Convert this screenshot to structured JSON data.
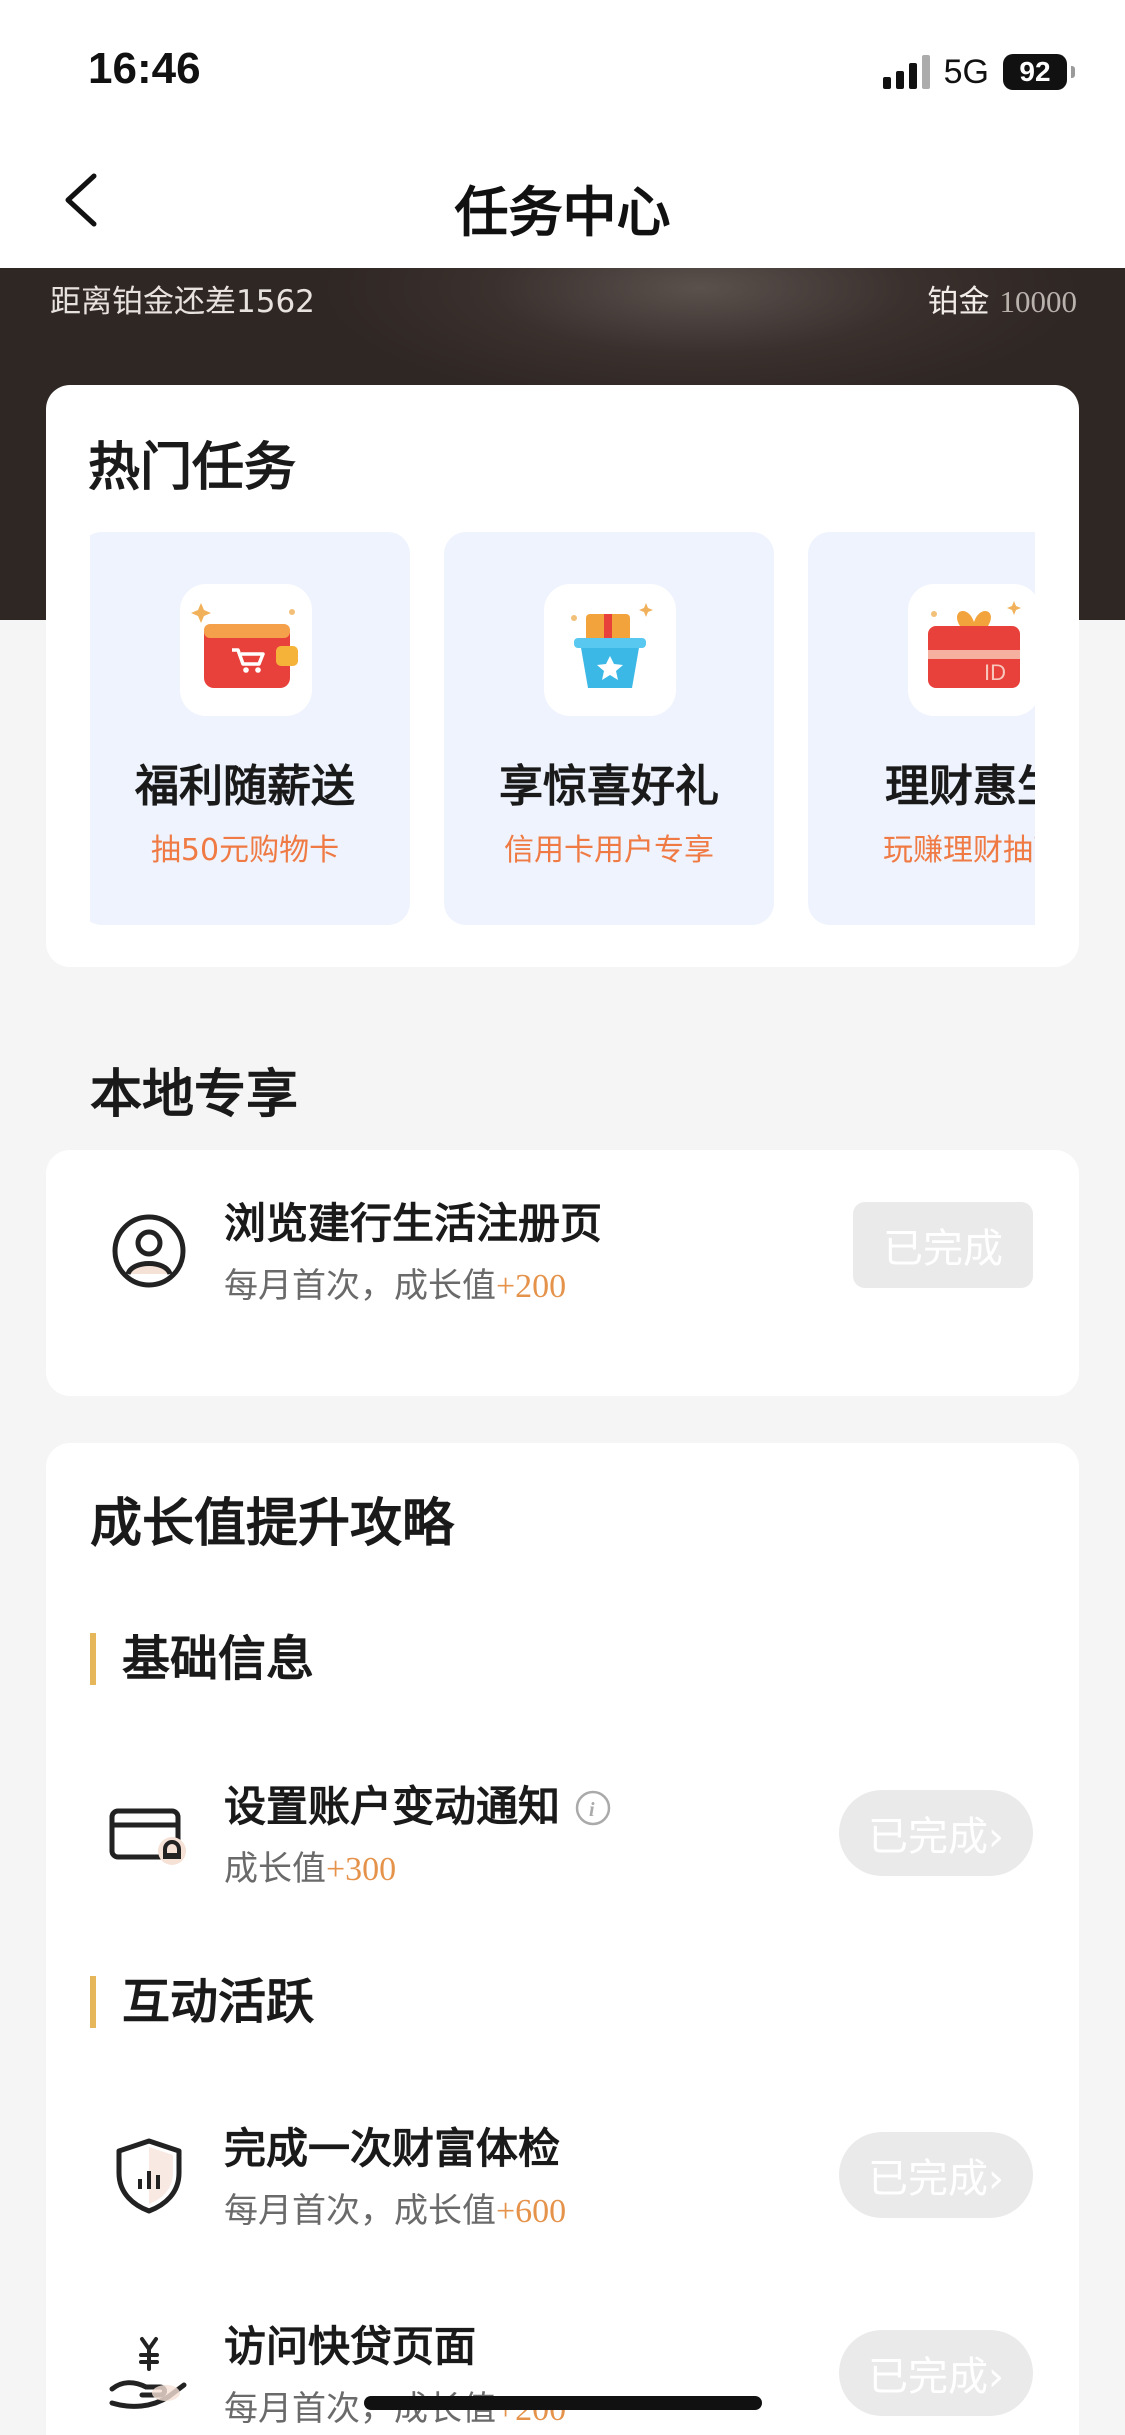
{
  "status": {
    "time": "16:46",
    "network": "5G",
    "battery": "92"
  },
  "nav": {
    "title": "任务中心"
  },
  "hero": {
    "progress_text": "距离铂金还差1562",
    "level_label": "铂金",
    "level_value": "10000"
  },
  "hot": {
    "title": "热门任务",
    "items": [
      {
        "name": "福利随薪送",
        "sub": "抽50元购物卡",
        "icon": "red-wallet-cart-icon"
      },
      {
        "name": "享惊喜好礼",
        "sub": "信用卡用户专享",
        "icon": "gift-basket-icon"
      },
      {
        "name": "理财惠生",
        "sub": "玩赚理财抽豪",
        "icon": "gift-card-icon"
      }
    ]
  },
  "local": {
    "title": "本地专享",
    "tasks": [
      {
        "name": "浏览建行生活注册页",
        "desc_prefix": "每月首次，成长值",
        "points": "+200",
        "status": "已完成",
        "icon": "user-profile-icon"
      }
    ]
  },
  "growth": {
    "title": "成长值提升攻略",
    "sections": [
      {
        "heading": "基础信息"
      },
      {
        "heading": "互动活跃"
      }
    ],
    "tasks": [
      {
        "name": "设置账户变动通知",
        "desc_prefix": "成长值",
        "points": "+300",
        "status": "已完成›",
        "icon": "card-bell-icon"
      },
      {
        "name": "完成一次财富体检",
        "desc_prefix": "每月首次，成长值",
        "points": "+600",
        "status": "已完成›",
        "icon": "shield-chart-icon"
      },
      {
        "name": "访问快贷页面",
        "desc_prefix": "每月首次，成长值",
        "points": "+200",
        "status": "已完成›",
        "icon": "hand-yuan-icon"
      }
    ]
  },
  "colors": {
    "accent_orange": "#f07a44",
    "points_orange": "#e5934b",
    "hero_dark": "#2f2724",
    "hot_item_bg": "#eef3fd",
    "section_bar": "#e6b65a"
  }
}
